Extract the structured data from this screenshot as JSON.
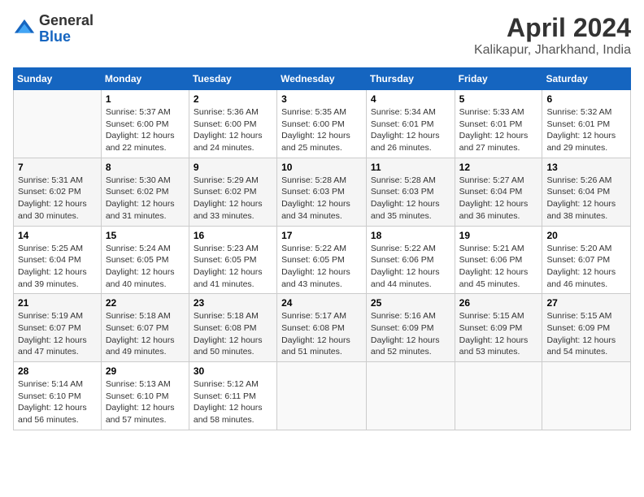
{
  "header": {
    "logo_line1": "General",
    "logo_line2": "Blue",
    "month": "April 2024",
    "location": "Kalikapur, Jharkhand, India"
  },
  "days_of_week": [
    "Sunday",
    "Monday",
    "Tuesday",
    "Wednesday",
    "Thursday",
    "Friday",
    "Saturday"
  ],
  "weeks": [
    [
      {
        "day": null,
        "info": null
      },
      {
        "day": "1",
        "info": "Sunrise: 5:37 AM\nSunset: 6:00 PM\nDaylight: 12 hours\nand 22 minutes."
      },
      {
        "day": "2",
        "info": "Sunrise: 5:36 AM\nSunset: 6:00 PM\nDaylight: 12 hours\nand 24 minutes."
      },
      {
        "day": "3",
        "info": "Sunrise: 5:35 AM\nSunset: 6:00 PM\nDaylight: 12 hours\nand 25 minutes."
      },
      {
        "day": "4",
        "info": "Sunrise: 5:34 AM\nSunset: 6:01 PM\nDaylight: 12 hours\nand 26 minutes."
      },
      {
        "day": "5",
        "info": "Sunrise: 5:33 AM\nSunset: 6:01 PM\nDaylight: 12 hours\nand 27 minutes."
      },
      {
        "day": "6",
        "info": "Sunrise: 5:32 AM\nSunset: 6:01 PM\nDaylight: 12 hours\nand 29 minutes."
      }
    ],
    [
      {
        "day": "7",
        "info": "Sunrise: 5:31 AM\nSunset: 6:02 PM\nDaylight: 12 hours\nand 30 minutes."
      },
      {
        "day": "8",
        "info": "Sunrise: 5:30 AM\nSunset: 6:02 PM\nDaylight: 12 hours\nand 31 minutes."
      },
      {
        "day": "9",
        "info": "Sunrise: 5:29 AM\nSunset: 6:02 PM\nDaylight: 12 hours\nand 33 minutes."
      },
      {
        "day": "10",
        "info": "Sunrise: 5:28 AM\nSunset: 6:03 PM\nDaylight: 12 hours\nand 34 minutes."
      },
      {
        "day": "11",
        "info": "Sunrise: 5:28 AM\nSunset: 6:03 PM\nDaylight: 12 hours\nand 35 minutes."
      },
      {
        "day": "12",
        "info": "Sunrise: 5:27 AM\nSunset: 6:04 PM\nDaylight: 12 hours\nand 36 minutes."
      },
      {
        "day": "13",
        "info": "Sunrise: 5:26 AM\nSunset: 6:04 PM\nDaylight: 12 hours\nand 38 minutes."
      }
    ],
    [
      {
        "day": "14",
        "info": "Sunrise: 5:25 AM\nSunset: 6:04 PM\nDaylight: 12 hours\nand 39 minutes."
      },
      {
        "day": "15",
        "info": "Sunrise: 5:24 AM\nSunset: 6:05 PM\nDaylight: 12 hours\nand 40 minutes."
      },
      {
        "day": "16",
        "info": "Sunrise: 5:23 AM\nSunset: 6:05 PM\nDaylight: 12 hours\nand 41 minutes."
      },
      {
        "day": "17",
        "info": "Sunrise: 5:22 AM\nSunset: 6:05 PM\nDaylight: 12 hours\nand 43 minutes."
      },
      {
        "day": "18",
        "info": "Sunrise: 5:22 AM\nSunset: 6:06 PM\nDaylight: 12 hours\nand 44 minutes."
      },
      {
        "day": "19",
        "info": "Sunrise: 5:21 AM\nSunset: 6:06 PM\nDaylight: 12 hours\nand 45 minutes."
      },
      {
        "day": "20",
        "info": "Sunrise: 5:20 AM\nSunset: 6:07 PM\nDaylight: 12 hours\nand 46 minutes."
      }
    ],
    [
      {
        "day": "21",
        "info": "Sunrise: 5:19 AM\nSunset: 6:07 PM\nDaylight: 12 hours\nand 47 minutes."
      },
      {
        "day": "22",
        "info": "Sunrise: 5:18 AM\nSunset: 6:07 PM\nDaylight: 12 hours\nand 49 minutes."
      },
      {
        "day": "23",
        "info": "Sunrise: 5:18 AM\nSunset: 6:08 PM\nDaylight: 12 hours\nand 50 minutes."
      },
      {
        "day": "24",
        "info": "Sunrise: 5:17 AM\nSunset: 6:08 PM\nDaylight: 12 hours\nand 51 minutes."
      },
      {
        "day": "25",
        "info": "Sunrise: 5:16 AM\nSunset: 6:09 PM\nDaylight: 12 hours\nand 52 minutes."
      },
      {
        "day": "26",
        "info": "Sunrise: 5:15 AM\nSunset: 6:09 PM\nDaylight: 12 hours\nand 53 minutes."
      },
      {
        "day": "27",
        "info": "Sunrise: 5:15 AM\nSunset: 6:09 PM\nDaylight: 12 hours\nand 54 minutes."
      }
    ],
    [
      {
        "day": "28",
        "info": "Sunrise: 5:14 AM\nSunset: 6:10 PM\nDaylight: 12 hours\nand 56 minutes."
      },
      {
        "day": "29",
        "info": "Sunrise: 5:13 AM\nSunset: 6:10 PM\nDaylight: 12 hours\nand 57 minutes."
      },
      {
        "day": "30",
        "info": "Sunrise: 5:12 AM\nSunset: 6:11 PM\nDaylight: 12 hours\nand 58 minutes."
      },
      {
        "day": null,
        "info": null
      },
      {
        "day": null,
        "info": null
      },
      {
        "day": null,
        "info": null
      },
      {
        "day": null,
        "info": null
      }
    ]
  ]
}
